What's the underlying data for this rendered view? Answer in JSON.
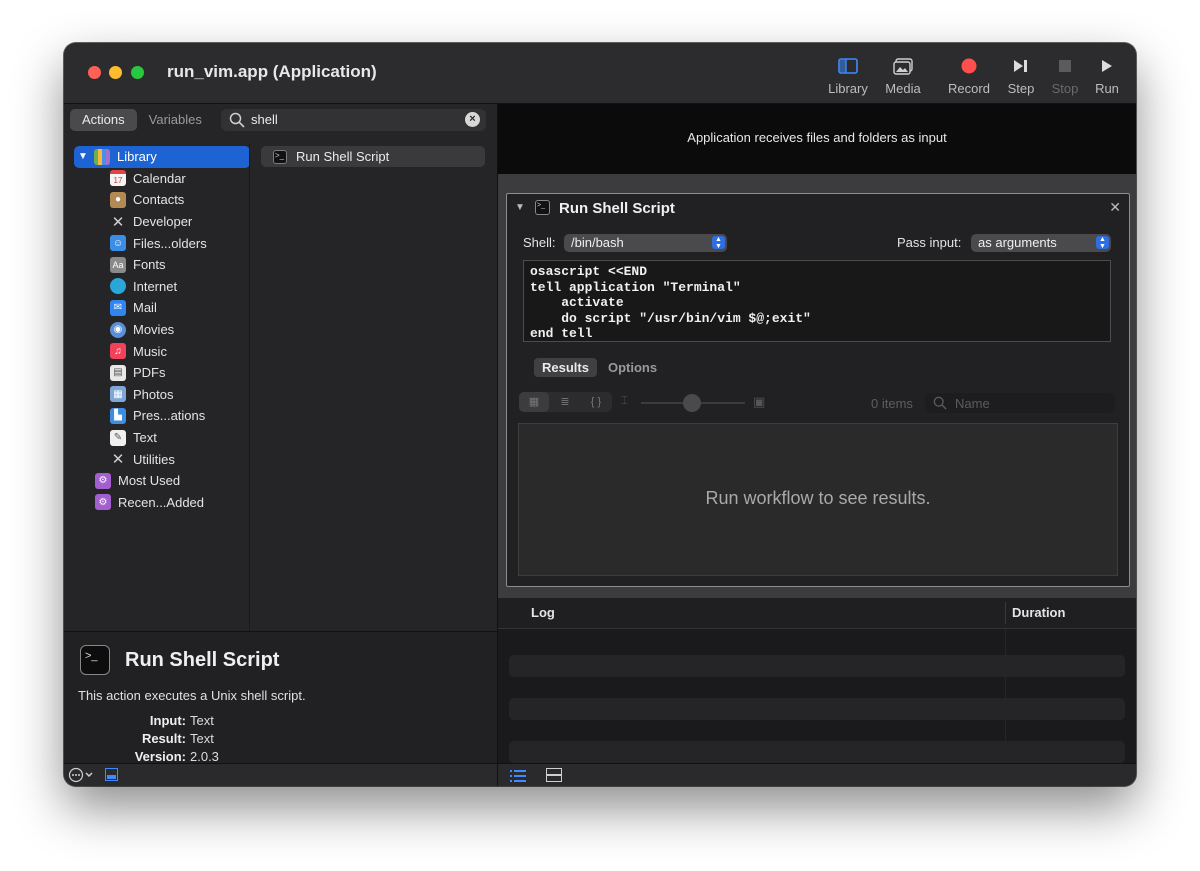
{
  "window": {
    "title": "run_vim.app (Application)"
  },
  "toolbar": {
    "library": "Library",
    "media": "Media",
    "record": "Record",
    "step": "Step",
    "stop": "Stop",
    "run": "Run"
  },
  "left": {
    "tabs": [
      "Actions",
      "Variables"
    ],
    "search": {
      "value": "shell"
    },
    "library": {
      "root": "Library",
      "items": [
        "Calendar",
        "Contacts",
        "Developer",
        "Files...olders",
        "Fonts",
        "Internet",
        "Mail",
        "Movies",
        "Music",
        "PDFs",
        "Photos",
        "Pres...ations",
        "Text",
        "Utilities"
      ],
      "smart": [
        "Most Used",
        "Recen...Added"
      ]
    },
    "action_result": "Run Shell Script",
    "description": {
      "title": "Run Shell Script",
      "text": "This action executes a Unix shell script.",
      "input_label": "Input:",
      "input_value": "Text",
      "result_label": "Result:",
      "result_value": "Text",
      "version_label": "Version:",
      "version_value": "2.0.3"
    }
  },
  "workflow": {
    "input_note": "Application receives files and folders as input",
    "action": {
      "title": "Run Shell Script",
      "shell_label": "Shell:",
      "shell_value": "/bin/bash",
      "pass_input_label": "Pass input:",
      "pass_input_value": "as arguments",
      "script": "osascript <<END\ntell application \"Terminal\"\n    activate\n    do script \"/usr/bin/vim $@;exit\"\nend tell",
      "tabs": [
        "Results",
        "Options"
      ],
      "items_count": "0 items",
      "name_placeholder": "Name",
      "empty_message": "Run workflow to see results."
    }
  },
  "log": {
    "col_log": "Log",
    "col_duration": "Duration"
  },
  "colors": {
    "accent": "#1d63d3",
    "record": "#fe4e4e"
  }
}
